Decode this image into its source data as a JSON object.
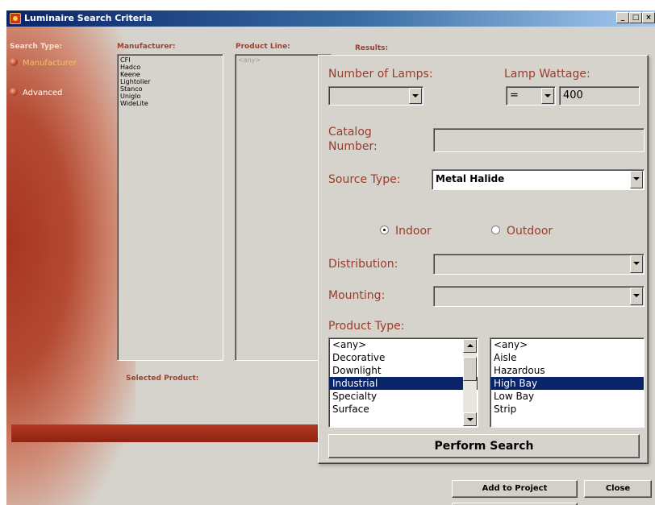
{
  "window": {
    "title": "Luminaire Search Criteria",
    "controls": {
      "minimize": "_",
      "maximize": "□",
      "close": "×"
    }
  },
  "search_type": {
    "label": "Search Type:",
    "options": [
      {
        "label": "Manufacturer",
        "selected": true
      },
      {
        "label": "Advanced",
        "selected": false
      }
    ]
  },
  "manufacturer": {
    "label": "Manufacturer:",
    "items": [
      "CFI",
      "Hadco",
      "Keene",
      "Lightolier",
      "Stanco",
      "Uniglo",
      "WideLite"
    ]
  },
  "product_line": {
    "label": "Product Line:",
    "items": [
      "<any>"
    ]
  },
  "results": {
    "label": "Results:"
  },
  "selected_product": {
    "label": "Selected Product:"
  },
  "footer": {
    "add_to_project": "Add to Project",
    "close": "Close"
  },
  "panel": {
    "number_of_lamps": {
      "label": "Number of Lamps:",
      "value": ""
    },
    "lamp_wattage": {
      "label": "Lamp Wattage:",
      "operator": "=",
      "value": "400"
    },
    "catalog_number": {
      "label": "Catalog Number:",
      "value": ""
    },
    "source_type": {
      "label": "Source Type:",
      "value": "Metal Halide"
    },
    "location": {
      "indoor": {
        "label": "Indoor",
        "selected": true
      },
      "outdoor": {
        "label": "Outdoor",
        "selected": false
      }
    },
    "distribution": {
      "label": "Distribution:",
      "value": ""
    },
    "mounting": {
      "label": "Mounting:",
      "value": ""
    },
    "product_type": {
      "label": "Product Type:",
      "left_list": [
        "<any>",
        "Decorative",
        "Downlight",
        "Industrial",
        "Specialty",
        "Surface"
      ],
      "left_selected": "Industrial",
      "right_list": [
        "<any>",
        "Aisle",
        "Hazardous",
        "High Bay",
        "Low Bay",
        "Strip"
      ],
      "right_selected": "High Bay"
    },
    "perform_search": "Perform Search"
  },
  "colors": {
    "title_bar": "#0a246a",
    "brand_red": "#a73520",
    "label_red": "#9c3a28",
    "selection": "#0a246a"
  }
}
